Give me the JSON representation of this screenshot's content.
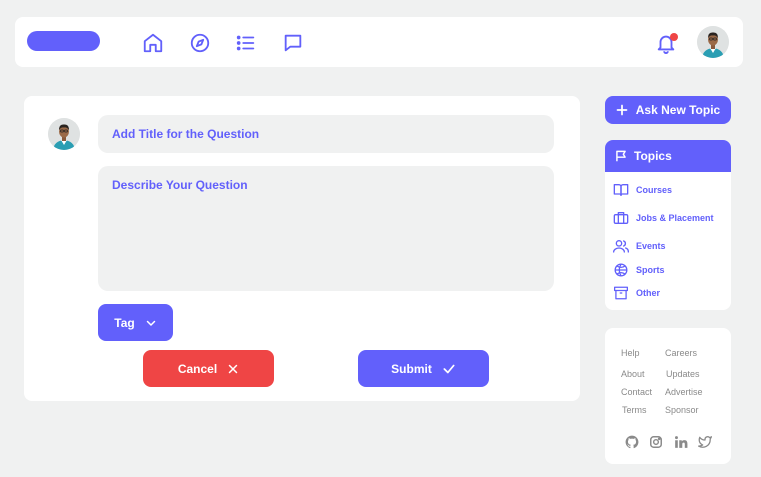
{
  "header": {
    "nav_icons": [
      "home-icon",
      "compass-icon",
      "list-icon",
      "chat-icon"
    ],
    "notification_icon": "bell-icon"
  },
  "composer": {
    "title_placeholder": "Add Title for the Question",
    "description_placeholder": "Describe Your Question",
    "tag_label": "Tag",
    "cancel_label": "Cancel",
    "submit_label": "Submit"
  },
  "sidebar": {
    "ask_new_topic_label": "Ask New Topic",
    "topics_heading": "Topics",
    "topics": [
      {
        "label": "Courses",
        "icon": "book-icon"
      },
      {
        "label": "Jobs & Placement",
        "icon": "briefcase-icon"
      },
      {
        "label": "Events",
        "icon": "people-icon"
      },
      {
        "label": "Sports",
        "icon": "basketball-icon"
      },
      {
        "label": "Other",
        "icon": "archive-icon"
      }
    ]
  },
  "footer": {
    "links": [
      {
        "label": "Help"
      },
      {
        "label": "Careers"
      },
      {
        "label": "About"
      },
      {
        "label": "Updates"
      },
      {
        "label": "Contact"
      },
      {
        "label": "Advertise"
      },
      {
        "label": "Terms"
      },
      {
        "label": "Sponsor"
      }
    ],
    "social_icons": [
      "github-icon",
      "instagram-icon",
      "linkedin-icon",
      "twitter-icon"
    ]
  },
  "colors": {
    "accent": "#6260fb",
    "danger": "#ef4545",
    "background": "#f0f1f1",
    "field_background": "#f0f1f1",
    "footer_text": "#8a8a8a"
  }
}
